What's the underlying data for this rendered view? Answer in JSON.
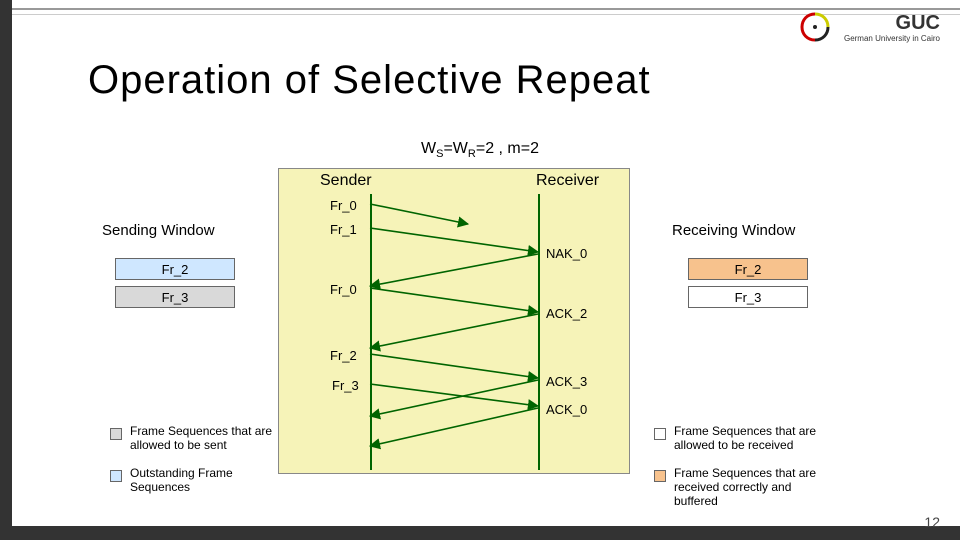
{
  "slide": {
    "title": "Operation of Selective Repeat",
    "number": "12",
    "logo_text": "GUC",
    "logo_sub": "German University in Cairo"
  },
  "params": {
    "text": "WS=WR=2 , m=2",
    "ws_label": "W",
    "ws_sub": "S",
    "wr_label": "W",
    "wr_sub": "R",
    "rest": "=2 , m=2"
  },
  "endpoints": {
    "sender": "Sender",
    "receiver": "Receiver"
  },
  "frame_labels": [
    "Fr_0",
    "Fr_1",
    "Fr_0",
    "Fr_2",
    "Fr_3"
  ],
  "event_labels": [
    "NAK_0",
    "ACK_2",
    "ACK_3",
    "ACK_0"
  ],
  "sending_window": {
    "header": "Sending Window",
    "cells": [
      {
        "label": "Fr_2",
        "fill": "#cfe7ff"
      },
      {
        "label": "Fr_3",
        "fill": "#d9d9d9"
      }
    ]
  },
  "receiving_window": {
    "header": "Receiving Window",
    "cells": [
      {
        "label": "Fr_2",
        "fill": "#f7c28d"
      },
      {
        "label": "Fr_3",
        "fill": "#ffffff"
      }
    ]
  },
  "legend": [
    {
      "swatch": "#d9d9d9",
      "text": "Frame Sequences that are allowed to be sent"
    },
    {
      "swatch": "#cfe7ff",
      "text": "Outstanding Frame Sequences"
    },
    {
      "swatch": "#ffffff",
      "text": "Frame Sequences that are allowed to be received"
    },
    {
      "swatch": "#f7c28d",
      "text": "Frame Sequences that are received correctly and buffered"
    }
  ],
  "colors": {
    "panel": "#f6f3b8",
    "line": "#006400",
    "frame": "#333"
  }
}
